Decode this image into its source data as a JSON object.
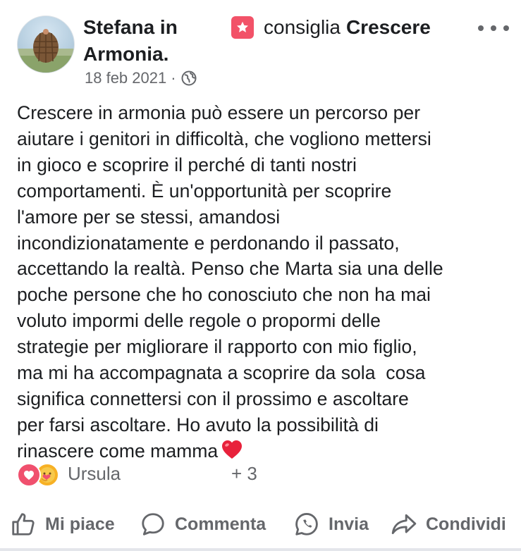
{
  "post": {
    "author": "Stefana in Armonia.",
    "recommend_verb": "consiglia",
    "recommended_page": "Crescere",
    "date": "18 feb 2021",
    "separator": "·",
    "text": "Crescere in armonia può essere un percorso per\naiutare i genitori in difficoltà, che vogliono mettersi\nin gioco e scoprire il perché di tanti nostri\ncomportamenti. È un'opportunità per scoprire\nl'amore per se stessi, amandosi\nincondizionatamente e perdonando il passato,\naccettando la realtà. Penso che Marta sia una delle\npoche persone che ho conosciuto che non ha mai\nvoluto impormi delle regole o propormi delle\nstrategie per migliorare il rapporto con mio figlio,\nma mi ha accompagnata a scoprire da sola  cosa\nsignifica connettersi con il prossimo e ascoltare\nper farsi ascoltare. Ho avuto la possibilità di\nrinascere come mamma"
  },
  "reactions": {
    "name": "Ursula",
    "others": "+ 3"
  },
  "actions": {
    "like": "Mi piace",
    "comment": "Commenta",
    "send": "Invia",
    "share": "Condividi"
  },
  "colors": {
    "text": "#1c1e21",
    "secondary": "#65676b",
    "recommend_badge": "#f25268",
    "love": "#f0506e",
    "care": "#f7b125"
  },
  "icons": [
    "globe-icon",
    "recommend-star-icon",
    "more-icon",
    "heart-emoji",
    "love-reaction-icon",
    "care-reaction-icon",
    "like-icon",
    "comment-icon",
    "whatsapp-icon",
    "share-icon"
  ]
}
